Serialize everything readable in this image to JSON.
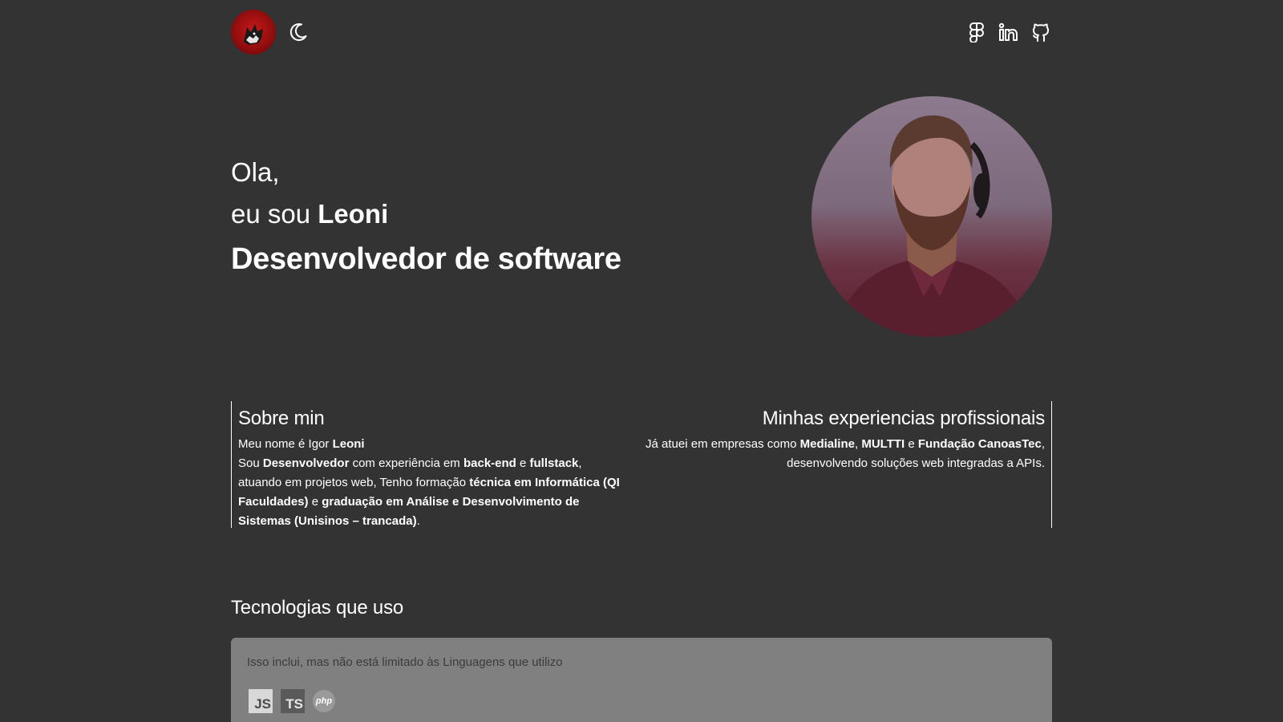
{
  "header": {
    "logo_icon": "wolf-logo",
    "theme_toggle_icon": "moon-icon",
    "social_icons": [
      "figma-icon",
      "linkedin-icon",
      "github-icon"
    ]
  },
  "hero": {
    "greeting": "Ola,",
    "intro_prefix": "eu sou ",
    "name": "Leoni",
    "role": "Desenvolvedor de software"
  },
  "about": {
    "title": "Sobre min",
    "line1_prefix": "Meu nome é Igor ",
    "line1_name": "Leoni",
    "p_sou": "Sou ",
    "p_dev": "Desenvolvedor",
    "p_exp": " com experiência em ",
    "p_backend": "back-end",
    "p_e1": " e ",
    "p_fullstack": "fullstack",
    "p_atuando": ", atuando em projetos web, Tenho formação ",
    "p_tecnica": "técnica em Informática (QI Faculdades)",
    "p_e2": " e ",
    "p_graduacao": "graduação em Análise e Desenvolvimento de Sistemas (Unisinos – trancada)",
    "p_end": "."
  },
  "experience": {
    "title": "Minhas experiencias profissionais",
    "prefix": "Já atuei em empresas como ",
    "company1": "Medialine",
    "sep1": ", ",
    "company2": "MULTTI",
    "sep2": " e ",
    "company3": "Fundação CanoasTec",
    "suffix": ", desenvolvendo soluções web integradas a APIs."
  },
  "tech": {
    "title": "Tecnologias que uso",
    "description": "Isso inclui, mas não está limitado às Linguagens que utilizo",
    "languages": [
      "JS",
      "TS",
      "php"
    ]
  },
  "colors": {
    "background": "#333333",
    "tech_box": "#808080",
    "text": "#ffffff",
    "logo_red": "#c81818"
  }
}
